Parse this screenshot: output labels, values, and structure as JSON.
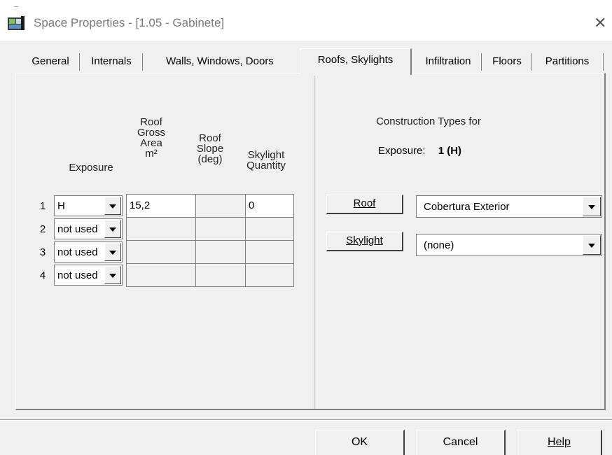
{
  "window": {
    "title": "Space Properties - [1.05 - Gabinete]",
    "close_glyph": "✕"
  },
  "tabs": [
    {
      "label": "General"
    },
    {
      "label": "Internals"
    },
    {
      "label": "Walls, Windows, Doors"
    },
    {
      "label": "Roofs, Skylights",
      "active": true
    },
    {
      "label": "Infiltration"
    },
    {
      "label": "Floors"
    },
    {
      "label": "Partitions"
    }
  ],
  "table": {
    "headers": {
      "exposure": "Exposure",
      "gross_area": [
        "Roof",
        "Gross",
        "Area",
        "m²"
      ],
      "slope": [
        "Roof",
        "Slope",
        "(deg)"
      ],
      "skylight": [
        "Skylight",
        "Quantity"
      ]
    },
    "rows": [
      {
        "num": "1",
        "exposure": "H",
        "gross_area": "15,2",
        "slope": "",
        "skylight_qty": "0"
      },
      {
        "num": "2",
        "exposure": "not used",
        "gross_area": "",
        "slope": "",
        "skylight_qty": ""
      },
      {
        "num": "3",
        "exposure": "not used",
        "gross_area": "",
        "slope": "",
        "skylight_qty": ""
      },
      {
        "num": "4",
        "exposure": "not used",
        "gross_area": "",
        "slope": "",
        "skylight_qty": ""
      }
    ]
  },
  "construction": {
    "heading": "Construction Types for",
    "exposure_label": "Exposure:",
    "exposure_value": "1 (H)",
    "roof_button": "Roof",
    "roof_value": "Cobertura Exterior",
    "skylight_button": "Skylight",
    "skylight_value": "(none)"
  },
  "footer": {
    "ok": "OK",
    "cancel": "Cancel",
    "help": "Help"
  },
  "colors": {
    "background": "#f0f0f0",
    "field_bg": "#ffffff",
    "shadow": "#808080"
  },
  "icons": [
    "app-icon",
    "close-icon",
    "dropdown-arrow-icon"
  ]
}
